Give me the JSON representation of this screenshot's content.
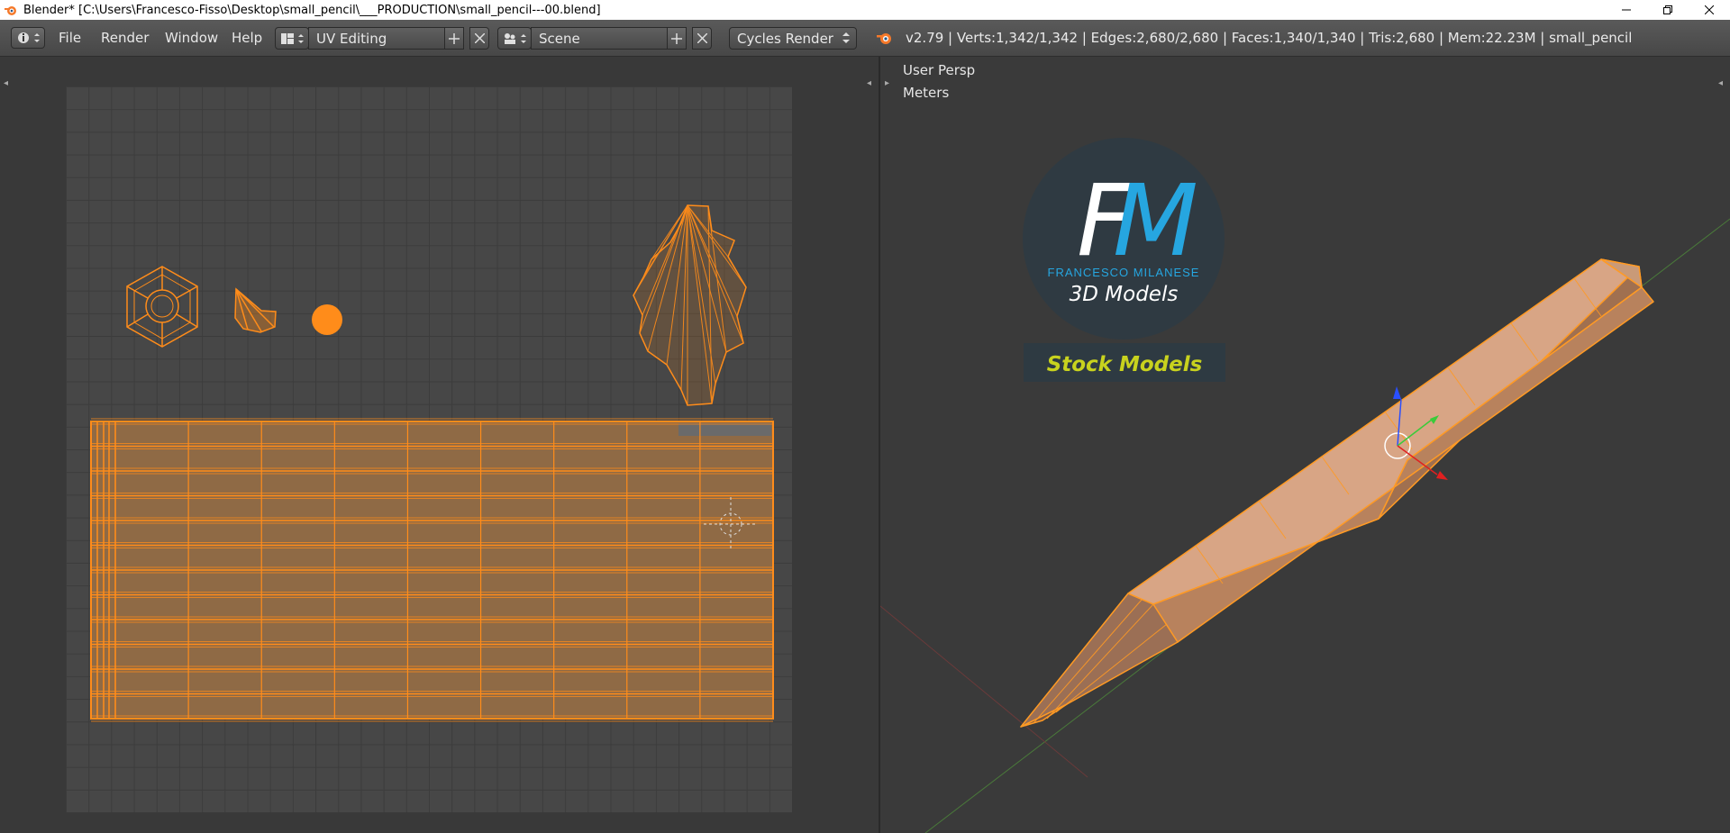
{
  "titlebar": {
    "title": "Blender* [C:\\Users\\Francesco-Fisso\\Desktop\\small_pencil\\___PRODUCTION\\small_pencil---00.blend]"
  },
  "menu": {
    "file": "File",
    "render": "Render",
    "window": "Window",
    "help": "Help"
  },
  "layout": {
    "name": "UV Editing"
  },
  "scene": {
    "name": "Scene"
  },
  "engine": {
    "name": "Cycles Render"
  },
  "stats": "v2.79 | Verts:1,342/1,342 | Edges:2,680/2,680 | Faces:1,340/1,340 | Tris:2,680 | Mem:22.23M | small_pencil",
  "viewport": {
    "view_label": "User Persp",
    "units_label": "Meters"
  },
  "watermark": {
    "logo_letters": "FM",
    "brand": "FRANCESCO MILANESE",
    "sub": "3D Models",
    "badge": "Stock Models"
  },
  "colors": {
    "accent_orange": "#ff8c1a",
    "viewport_bg": "#3a3a3a",
    "uv_bg": "#474747",
    "badge_text": "#c8d21e",
    "logo_blue": "#26a6e0"
  },
  "icons": {
    "editor_type": "info-icon",
    "layout": "screen-layout-icon",
    "scene": "scene-icon",
    "blender": "blender-logo-icon"
  }
}
